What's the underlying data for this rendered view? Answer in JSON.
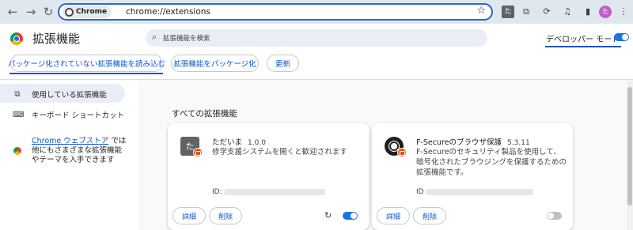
{
  "browser": {
    "chip_label": "Chrome",
    "url": "chrome://extensions",
    "toolbar_ext_label": "た",
    "avatar_initial": "た"
  },
  "header": {
    "title": "拡張機能",
    "search_placeholder": "拡張機能を検索",
    "dev_mode_label": "デベロッパー モード",
    "dev_mode_on": true
  },
  "actions": {
    "load_unpacked": "パッケージ化されていない拡張機能を読み込む",
    "pack": "拡張機能をパッケージ化",
    "update": "更新"
  },
  "sidebar": {
    "items": [
      {
        "label": "使用している拡張機能",
        "icon": "puzzle-icon",
        "active": true
      },
      {
        "label": "キーボード ショートカット",
        "icon": "keyboard-icon",
        "active": false
      }
    ],
    "store_link": "Chrome ウェブストア",
    "store_text_1": " では",
    "store_text_2": "他にもさまざまな拡張機能",
    "store_text_3": "やテーマを入手できます"
  },
  "main": {
    "section_title": "すべての拡張機能",
    "extensions": [
      {
        "name": "ただいま",
        "version": "1.0.0",
        "icon_label": "た",
        "description": "修学支援システムを開くと歓迎されます",
        "id_label": "ID:",
        "details": "詳細",
        "remove": "削除",
        "enabled": true,
        "has_reload": true
      },
      {
        "name": "F-Secureのブラウザ保護",
        "version": "5.3.11",
        "description": "F-Secureのセキュリティ製品を使用して、暗号化されたブラウジングを保護するための拡張機能です。",
        "id_label": "ID",
        "details": "詳細",
        "remove": "削除",
        "enabled": false,
        "has_reload": false
      }
    ]
  },
  "colors": {
    "accent": "#1a73e8",
    "link": "#0b57d0",
    "badge": "#e3531e"
  }
}
